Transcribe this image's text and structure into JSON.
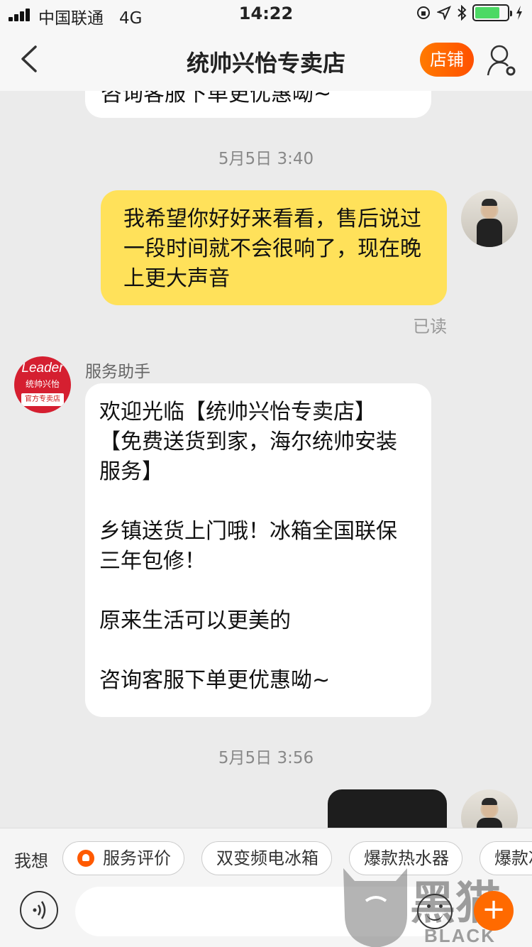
{
  "status_bar": {
    "carrier": "中国联通",
    "network": "4G",
    "time": "14:22"
  },
  "header": {
    "title": "统帅兴怡专卖店",
    "shop_button": "店铺"
  },
  "messages": {
    "partial_top": "咨询客服下单更优惠呦~",
    "ts1": "5月5日 3:40",
    "user_msg_1": "我希望你好好来看看，售后说过一段时间就不会很响了，现在晚上更大声音",
    "read_label": "已读",
    "sender": "服务助手",
    "shop_logo_brand": "Leader",
    "shop_logo_cn": "统帅兴怡",
    "shop_logo_tag": "官方专卖店",
    "shop_line1": "欢迎光临【统帅兴怡专卖店】",
    "shop_line2": "【免费送货到家，海尔统帅安装",
    "shop_line3": "服务】",
    "shop_line4": "乡镇送货上门哦！冰箱全国联保",
    "shop_line5": "三年包修！",
    "shop_line6": "原来生活可以更美的",
    "shop_line7": "咨询客服下单更优惠呦~",
    "ts2": "5月5日 3:56"
  },
  "quick_bar": {
    "lead": "我想",
    "chips": [
      "服务评价",
      "双变频电冰箱",
      "爆款热水器",
      "爆款冰"
    ]
  },
  "watermark": {
    "text_cn": "黑猫",
    "text_en": "BLACK CAT"
  }
}
